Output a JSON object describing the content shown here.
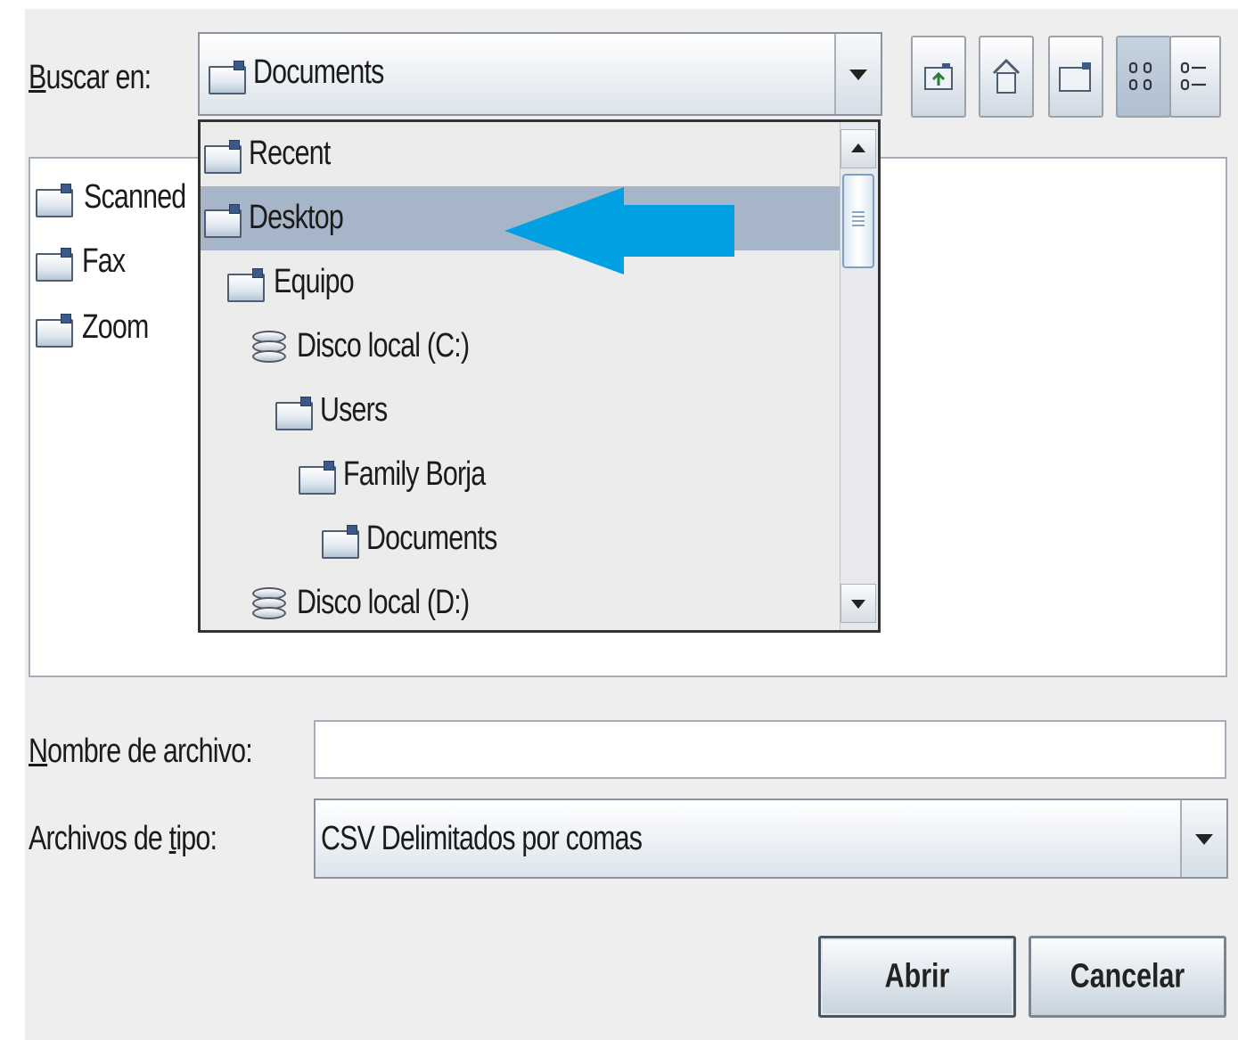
{
  "dialog": {
    "look_in_label": "Buscar en:",
    "look_in_mnemonic": "B",
    "look_in_rest": "uscar en:",
    "look_in_value": "Documents",
    "toolbar": {
      "icons": [
        "up-one-level-icon",
        "home-icon",
        "new-folder-icon",
        "list-view-icon",
        "details-view-icon"
      ],
      "list_view_glyph": "88\n88",
      "details_view_glyph": "0-\n0-"
    },
    "files": [
      {
        "label": "Scanned",
        "icon": "folder-icon"
      },
      {
        "label": "Fax",
        "icon": "folder-icon"
      },
      {
        "label": "Zoom",
        "icon": "folder-icon"
      }
    ],
    "dropdown": {
      "items": [
        {
          "label": "Recent",
          "icon": "folder-icon",
          "selected": false
        },
        {
          "label": "Desktop",
          "icon": "folder-icon",
          "selected": true
        },
        {
          "label": "Equipo",
          "icon": "folder-icon",
          "selected": false
        },
        {
          "label": "Disco local (C:)",
          "icon": "disk-icon",
          "selected": false
        },
        {
          "label": "Users",
          "icon": "folder-icon",
          "selected": false
        },
        {
          "label": "Family Borja",
          "icon": "folder-icon",
          "selected": false
        },
        {
          "label": "Documents",
          "icon": "folder-icon",
          "selected": false
        },
        {
          "label": "Disco local (D:)",
          "icon": "disk-icon",
          "selected": false
        }
      ],
      "highlight_color": "#a6b5c8",
      "annotation_arrow_color": "#00a0e3"
    },
    "filename_mnemonic": "N",
    "filename_rest": "ombre de archivo:",
    "filename_value": "",
    "filetype_pre": "Archivos de ",
    "filetype_mnemonic": "t",
    "filetype_rest": "ipo:",
    "filetype_value": "CSV Delimitados por comas",
    "open_button": "Abrir",
    "cancel_button": "Cancelar"
  }
}
